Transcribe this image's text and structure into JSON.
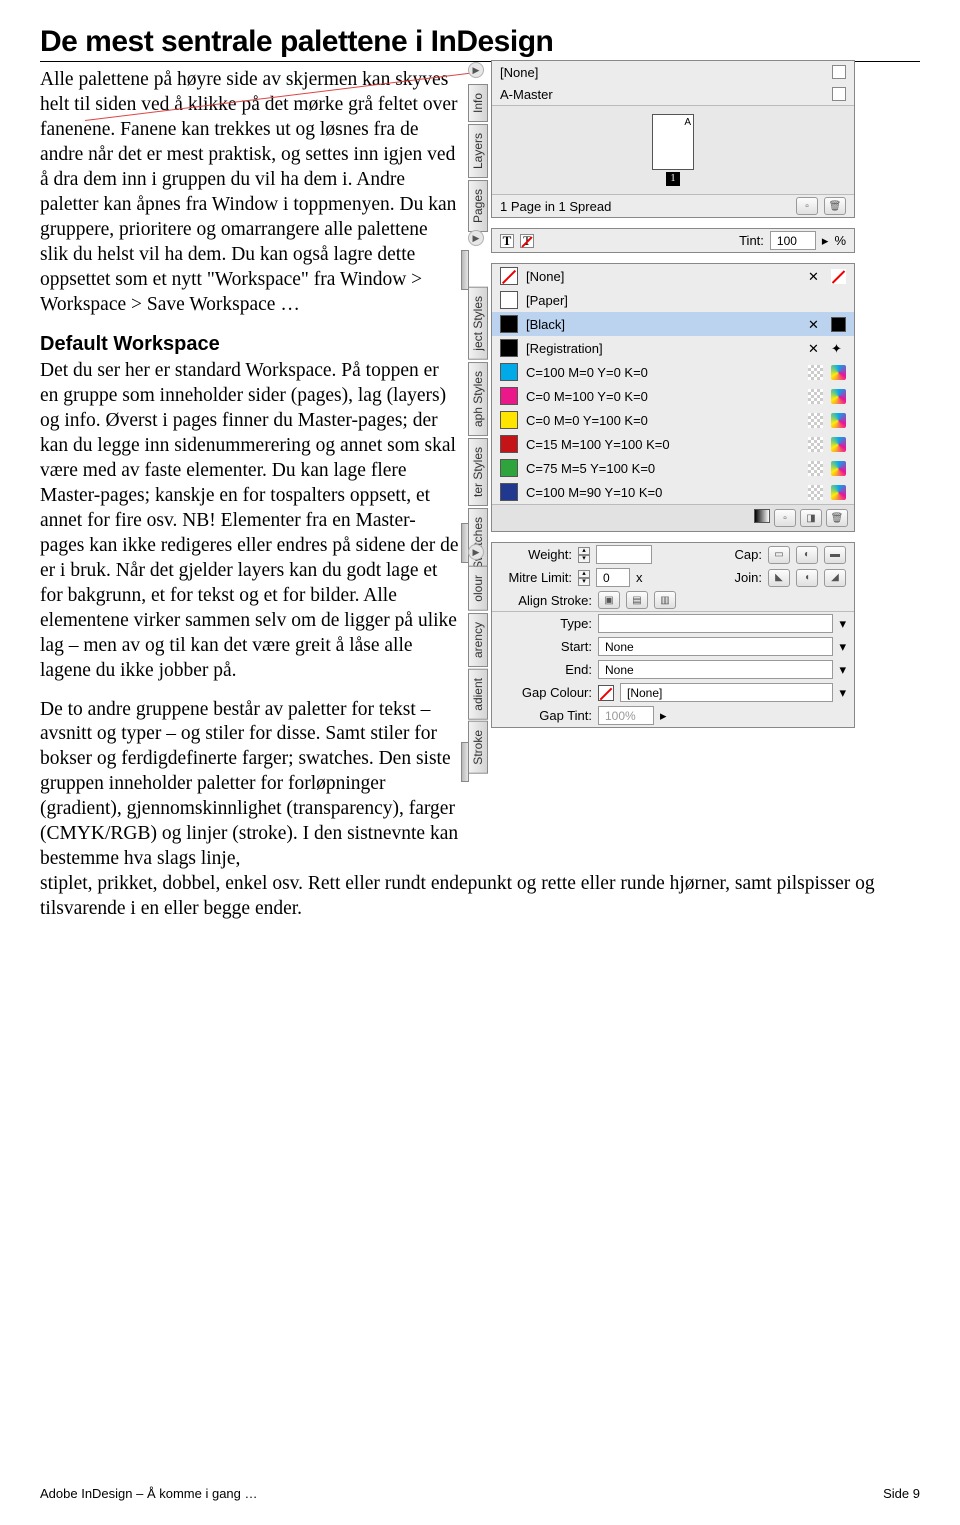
{
  "heading": "De mest sentrale palettene i InDesign",
  "p1": "Alle palettene på høyre side av skjermen kan skyves helt til siden ved å klikke på det mørke grå feltet over fanenene. Fanene kan trekkes ut og løsnes fra de andre når det er mest praktisk, og settes inn igjen ved å dra dem inn i gruppen du vil ha dem i. Andre paletter kan åpnes fra Window i toppmenyen. Du kan gruppere, prioritere og omarrangere alle palettene slik du helst vil ha dem. Du kan også lagre dette oppsettet som et nytt \"Workspace\" fra Window > Workspace > Save Workspace …",
  "h2": "Default Workspace",
  "p2": "Det du ser her er standard Workspace. På toppen er en gruppe som inneholder sider (pages), lag (layers) og info. Øverst i pages finner du Master-pages; der kan du legge inn sidenummerering og annet som skal være med av faste elementer. Du kan lage flere Master-pages; kanskje en for tospalters oppsett, et annet for fire osv. NB! Elementer fra en Master-pages kan ikke redigeres eller endres på sidene der de er i bruk. Når det gjelder layers kan du godt lage et for bakgrunn, et for tekst og et for bilder. Alle elementene virker sammen selv om de ligger på ulike lag – men av og til kan det være greit å låse alle lagene du ikke jobber på.",
  "p3": "De to andre gruppene består av paletter for tekst – avsnitt og typer – og stiler for disse. Samt stiler for bokser og ferdigdefinerte farger; swatches. Den siste gruppen inneholder paletter for forløpninger (gradient), gjennomskinnlighet (transparency), farger (CMYK/RGB) og linjer (stroke). I den sistnevnte kan bestemme hva slags linje,",
  "p4": "stiplet, prikket, dobbel, enkel osv. Rett eller rundt endepunkt og rette eller runde hjørner, samt pilspisser og tilsvarende i en eller begge ender.",
  "footer_left": "Adobe InDesign – Å komme i gang …",
  "footer_right": "Side 9",
  "pages": {
    "tabs": [
      "Info",
      "Layers",
      "Pages"
    ],
    "rows": [
      "[None]",
      "A-Master"
    ],
    "thumb_label": "A",
    "status": "1 Page in 1 Spread"
  },
  "char": {
    "tint_label": "Tint:",
    "tint_value": "100",
    "tint_unit": "%"
  },
  "swatches": {
    "tabs": [
      "ject Styles",
      "aph Styles",
      "ter Styles",
      "Swatches"
    ],
    "items": [
      {
        "name": "[None]",
        "color": "none"
      },
      {
        "name": "[Paper]",
        "color": "#ffffff"
      },
      {
        "name": "[Black]",
        "color": "#000000",
        "selected": true
      },
      {
        "name": "[Registration]",
        "color": "#000000"
      },
      {
        "name": "C=100 M=0 Y=0 K=0",
        "color": "#00a9e8"
      },
      {
        "name": "C=0 M=100 Y=0 K=0",
        "color": "#ea1889"
      },
      {
        "name": "C=0 M=0 Y=100 K=0",
        "color": "#fee500"
      },
      {
        "name": "C=15 M=100 Y=100 K=0",
        "color": "#c41418"
      },
      {
        "name": "C=75 M=5 Y=100 K=0",
        "color": "#2fa33c"
      },
      {
        "name": "C=100 M=90 Y=10 K=0",
        "color": "#20388e"
      }
    ]
  },
  "stroke": {
    "tabs": [
      "olour",
      "arency",
      "adient",
      "Stroke"
    ],
    "weight_label": "Weight:",
    "cap_label": "Cap:",
    "mitre_label": "Mitre Limit:",
    "mitre_value": "0",
    "mitre_unit": "x",
    "join_label": "Join:",
    "align_label": "Align Stroke:",
    "type_label": "Type:",
    "start_label": "Start:",
    "start_value": "None",
    "end_label": "End:",
    "end_value": "None",
    "gapcol_label": "Gap Colour:",
    "gapcol_value": "[None]",
    "gaptint_label": "Gap Tint:",
    "gaptint_value": "100%"
  }
}
